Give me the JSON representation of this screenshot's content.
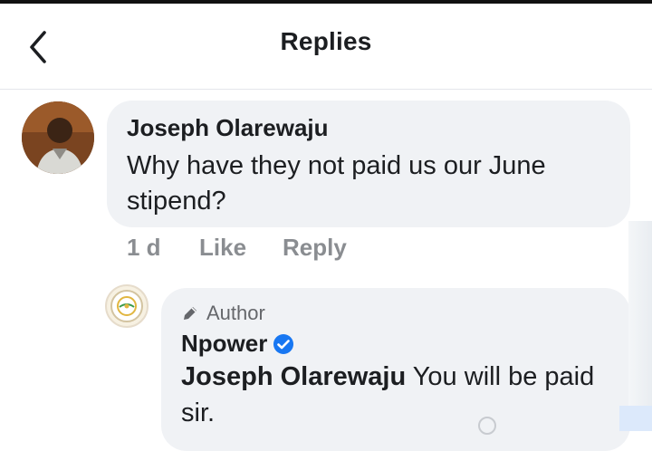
{
  "header": {
    "title": "Replies"
  },
  "comment": {
    "author": "Joseph Olarewaju",
    "text": "Why have they not paid us our June stipend?",
    "time": "1 d",
    "like_label": "Like",
    "reply_label": "Reply"
  },
  "reply": {
    "badge_label": "Author",
    "author": "Npower",
    "mention": "Joseph Olarewaju",
    "text": "You will be paid sir."
  },
  "icons": {
    "back": "chevron-left-icon",
    "badge": "pencil-icon",
    "verified": "verified-badge-icon"
  },
  "colors": {
    "bubble": "#f0f2f5",
    "verified": "#1877f2",
    "muted": "#8a8d91"
  }
}
